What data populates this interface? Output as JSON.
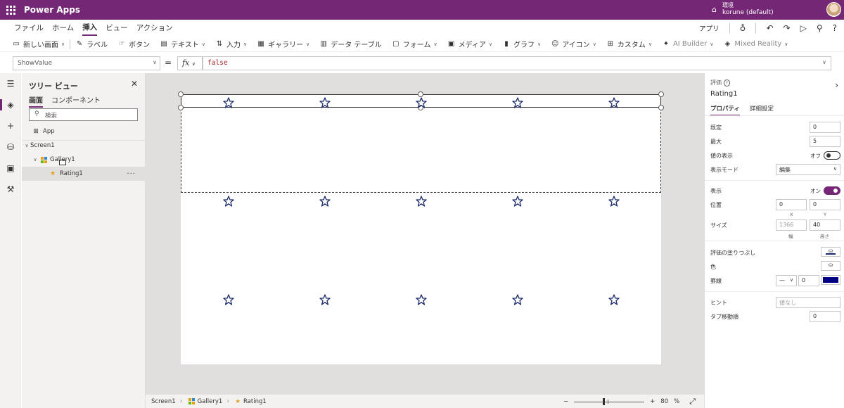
{
  "topbar": {
    "app_name": "Power Apps",
    "env_label": "環境",
    "env_name": "korune (default)"
  },
  "menubar": {
    "items": [
      "ファイル",
      "ホーム",
      "挿入",
      "ビュー",
      "アクション"
    ],
    "active": "挿入",
    "right": {
      "app_label": "アプリ"
    }
  },
  "ribbon": {
    "items": [
      {
        "label": "新しい画面",
        "icon": "new-screen-icon",
        "glyph": "▭",
        "chevron": true
      },
      {
        "label": "ラベル",
        "icon": "label-icon",
        "glyph": "✎",
        "chevron": false
      },
      {
        "label": "ボタン",
        "icon": "button-icon",
        "glyph": "☞",
        "chevron": false
      },
      {
        "label": "テキスト",
        "icon": "text-icon",
        "glyph": "▤",
        "chevron": true
      },
      {
        "label": "入力",
        "icon": "input-icon",
        "glyph": "⇅",
        "chevron": true
      },
      {
        "label": "ギャラリー",
        "icon": "gallery-icon",
        "glyph": "▦",
        "chevron": true
      },
      {
        "label": "データ テーブル",
        "icon": "data-table-icon",
        "glyph": "▥",
        "chevron": false
      },
      {
        "label": "フォーム",
        "icon": "form-icon",
        "glyph": "▢",
        "chevron": true
      },
      {
        "label": "メディア",
        "icon": "media-icon",
        "glyph": "▣",
        "chevron": true
      },
      {
        "label": "グラフ",
        "icon": "chart-icon",
        "glyph": "▮",
        "chevron": true
      },
      {
        "label": "アイコン",
        "icon": "shapes-icon",
        "glyph": "☺",
        "chevron": true
      },
      {
        "label": "カスタム",
        "icon": "custom-icon",
        "glyph": "⊞",
        "chevron": true
      },
      {
        "label": "AI Builder",
        "icon": "ai-builder-icon",
        "glyph": "✦",
        "chevron": true
      },
      {
        "label": "Mixed Reality",
        "icon": "mixed-reality-icon",
        "glyph": "◈",
        "chevron": true
      }
    ]
  },
  "formula": {
    "property": "ShowValue",
    "fx": "fx",
    "value": "false"
  },
  "tree": {
    "title": "ツリー ビュー",
    "tabs": [
      "画面",
      "コンポーネント"
    ],
    "search_placeholder": "検索",
    "nodes": {
      "app": "App",
      "screen": "Screen1",
      "gallery": "Gallery1",
      "rating": "Rating1",
      "more": "···"
    }
  },
  "canvas": {
    "rows": 3,
    "stars_per_row": 5,
    "star_color": "#1c2a6b"
  },
  "statusbar": {
    "crumbs": [
      "Screen1",
      "Gallery1",
      "Rating1"
    ],
    "zoom_value": "80",
    "zoom_unit": "%"
  },
  "props": {
    "control_type": "評価",
    "control_name": "Rating1",
    "tabs": [
      "プロパティ",
      "詳細設定"
    ],
    "default_label": "既定",
    "default_value": "0",
    "max_label": "最大",
    "max_value": "5",
    "show_value_label": "値の表示",
    "show_value_state": "オフ",
    "display_mode_label": "表示モード",
    "display_mode_value": "編集",
    "visible_label": "表示",
    "visible_state": "オン",
    "position_label": "位置",
    "x_value": "0",
    "y_value": "0",
    "x_label": "X",
    "y_label": "Y",
    "size_label": "サイズ",
    "width_value": "1366",
    "height_value": "40",
    "width_label": "幅",
    "height_label": "高さ",
    "rating_fill_label": "評価の塗りつぶし",
    "color_label": "色",
    "border_label": "罫線",
    "border_width": "0",
    "hint_label": "ヒント",
    "hint_placeholder": "値なし",
    "tab_index_label": "タブ移動順",
    "tab_index_value": "0",
    "border_color": "#000080"
  }
}
